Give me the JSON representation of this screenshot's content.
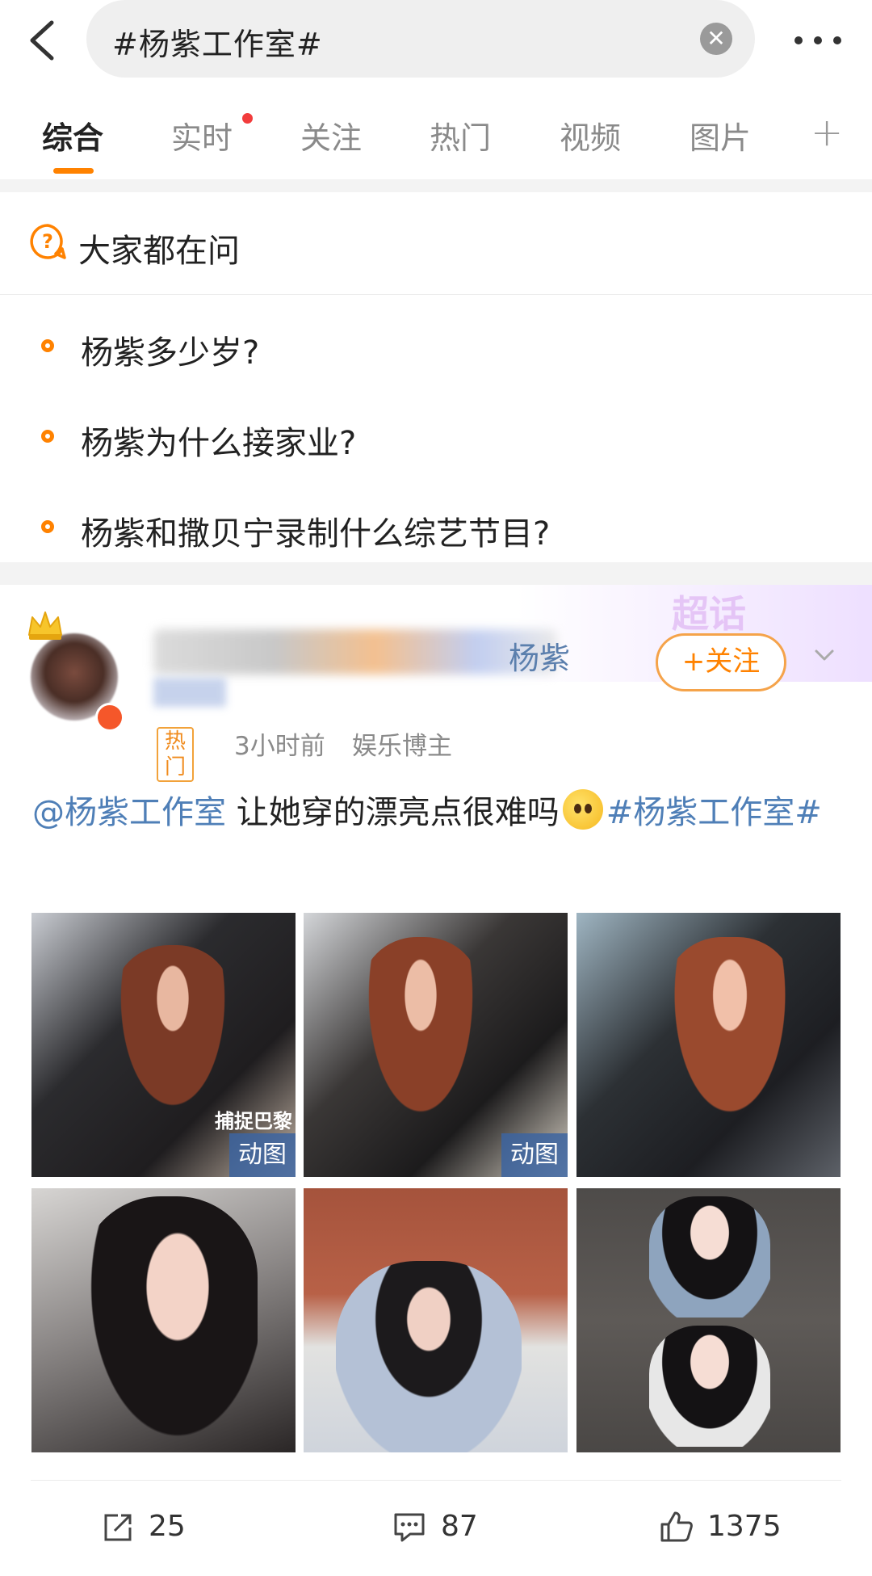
{
  "header": {
    "search_text": "#杨紫工作室#",
    "clear_icon": "close-circle-icon",
    "more_icon": "ellipsis-icon"
  },
  "tabs": [
    {
      "label": "综合",
      "active": true
    },
    {
      "label": "实时",
      "has_dot": true
    },
    {
      "label": "关注"
    },
    {
      "label": "热门"
    },
    {
      "label": "视频"
    },
    {
      "label": "图片"
    }
  ],
  "tabs_add": "+",
  "ask": {
    "title": "大家都在问",
    "questions": [
      "杨紫多少岁?",
      "杨紫为什么接家业?",
      "杨紫和撒贝宁录制什么综艺节目?"
    ]
  },
  "post": {
    "username_visible": "杨紫",
    "username_line2": "超话",
    "follow_label": "+关注",
    "supertopic_deco": "超话",
    "hot_tag": "热门",
    "time": "3小时前",
    "role": "娱乐博主",
    "mention": "@杨紫工作室",
    "text": " 让她穿的漂亮点很难吗",
    "hashtag": "#杨紫工作室#",
    "images": [
      {
        "gif": true,
        "label": "动图",
        "caption": "捕捉巴黎"
      },
      {
        "gif": true,
        "label": "动图"
      },
      {
        "gif": false
      },
      {
        "gif": false
      },
      {
        "gif": false
      },
      {
        "gif": false
      }
    ],
    "actions": {
      "repost": "25",
      "comments": "87",
      "likes": "1375"
    }
  },
  "colors": {
    "accent": "#ff8200",
    "link": "#4f7fb7"
  }
}
